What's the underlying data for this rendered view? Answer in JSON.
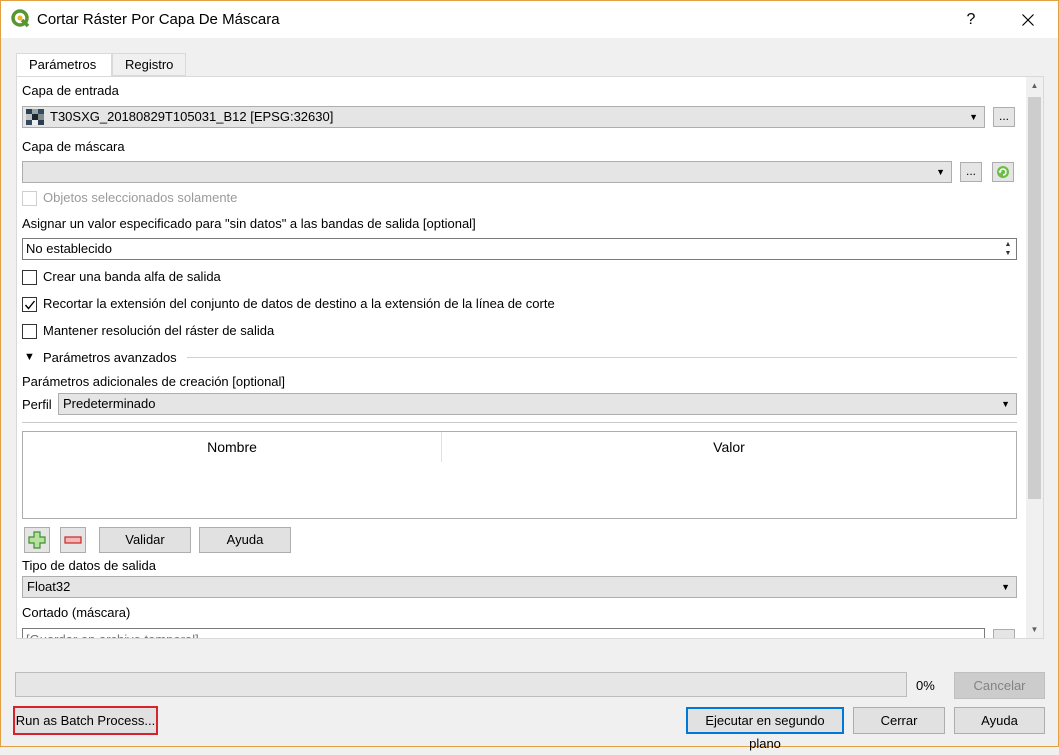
{
  "window": {
    "title": "Cortar Ráster Por Capa De Máscara",
    "help_label": "?",
    "close_label": "✕"
  },
  "tabs": [
    {
      "label": "Parámetros",
      "active": true
    },
    {
      "label": "Registro",
      "active": false
    }
  ],
  "params": {
    "input_layer": {
      "label": "Capa de entrada",
      "value": "T30SXG_20180829T105031_B12 [EPSG:32630]",
      "browse_label": "..."
    },
    "mask_layer": {
      "label": "Capa de máscara",
      "value": "",
      "browse_label": "..."
    },
    "selected_only": {
      "label": "Objetos seleccionados solamente",
      "checked": false,
      "enabled": false
    },
    "nodata": {
      "label": "Asignar un valor especificado para \"sin datos\" a las bandas de salida [optional]",
      "value": "No establecido"
    },
    "alpha_band": {
      "label": "Crear una banda alfa de salida",
      "checked": false
    },
    "crop_extent": {
      "label": "Recortar la extensión del conjunto de datos de destino a la extensión de la línea de corte",
      "checked": true
    },
    "keep_resolution": {
      "label": "Mantener resolución del ráster de salida",
      "checked": false
    },
    "advanced": {
      "label": "Parámetros avanzados"
    },
    "creation_options": {
      "label": "Parámetros adicionales de creación [optional]",
      "profile_label": "Perfil",
      "profile_value": "Predeterminado",
      "columns": [
        "Nombre",
        "Valor"
      ],
      "validate_label": "Validar",
      "help_label": "Ayuda"
    },
    "output_type": {
      "label": "Tipo de datos de salida",
      "value": "Float32"
    },
    "output": {
      "label": "Cortado (máscara)",
      "placeholder": "[Guardar en archivo temporal]"
    }
  },
  "progress": {
    "value": 0,
    "text": "0%"
  },
  "buttons": {
    "cancel": "Cancelar",
    "batch": "Run as Batch Process...",
    "background": "Ejecutar en segundo plano",
    "close": "Cerrar",
    "help": "Ayuda"
  },
  "colors": {
    "accent": "#0078d7",
    "highlight_red": "#d6242d",
    "qgis_green": "#589632"
  },
  "icons": [
    "qgis-logo-icon",
    "raster-layer-icon",
    "refresh-green-icon",
    "add-plus-icon",
    "remove-minus-icon",
    "chevron-down-icon",
    "triangle-collapse-icon"
  ]
}
